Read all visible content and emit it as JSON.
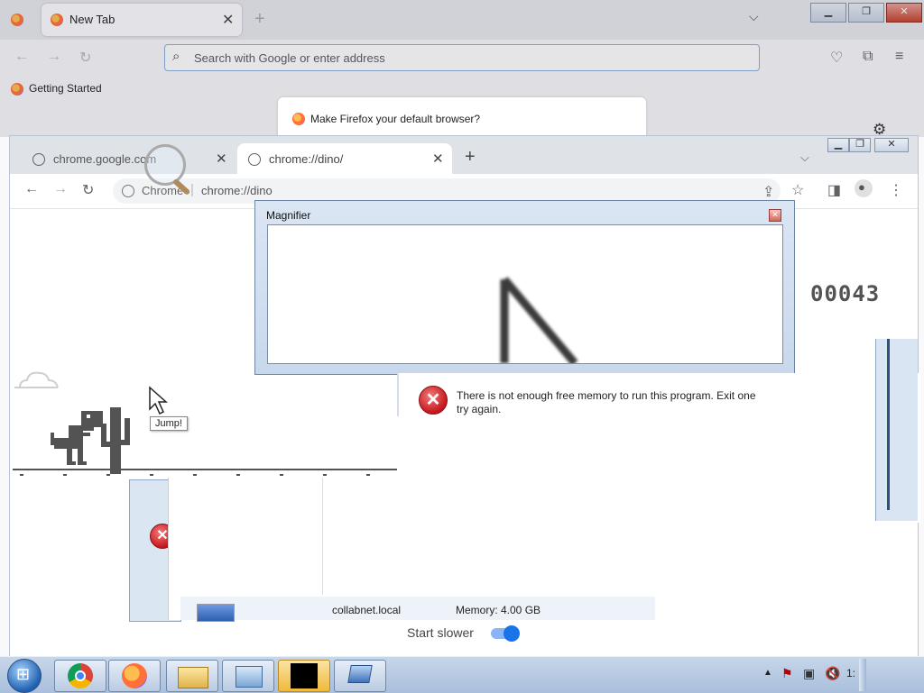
{
  "firefox": {
    "tab_title": "New Tab",
    "address_placeholder": "Search with Google or enter address",
    "bookmark": "Getting Started",
    "notification": "Make Firefox your default browser?"
  },
  "chrome": {
    "tabs": [
      {
        "title": "chrome.google.com"
      },
      {
        "title": "chrome://dino/"
      }
    ],
    "omnibox_prefix": "Chrome",
    "omnibox_url": "chrome://dino",
    "new_tab_symbol": "+"
  },
  "dino": {
    "score": "00043",
    "tooltip": "Jump!",
    "settings_label": "Start slower",
    "settings_toggle_on": true
  },
  "magnifier": {
    "title": "Magnifier"
  },
  "error": {
    "line1": "There is not enough free memory to run this program. Exit one",
    "line2": "try again."
  },
  "sysinfo": {
    "host": "collabnet.local",
    "memory": "Memory:  4.00 GB"
  },
  "taskbar": {
    "clock": "1:"
  },
  "colors": {
    "accent_toggle": "#1a73e8",
    "error_red": "#c5161d",
    "taskbar": "#b3c7e0"
  }
}
